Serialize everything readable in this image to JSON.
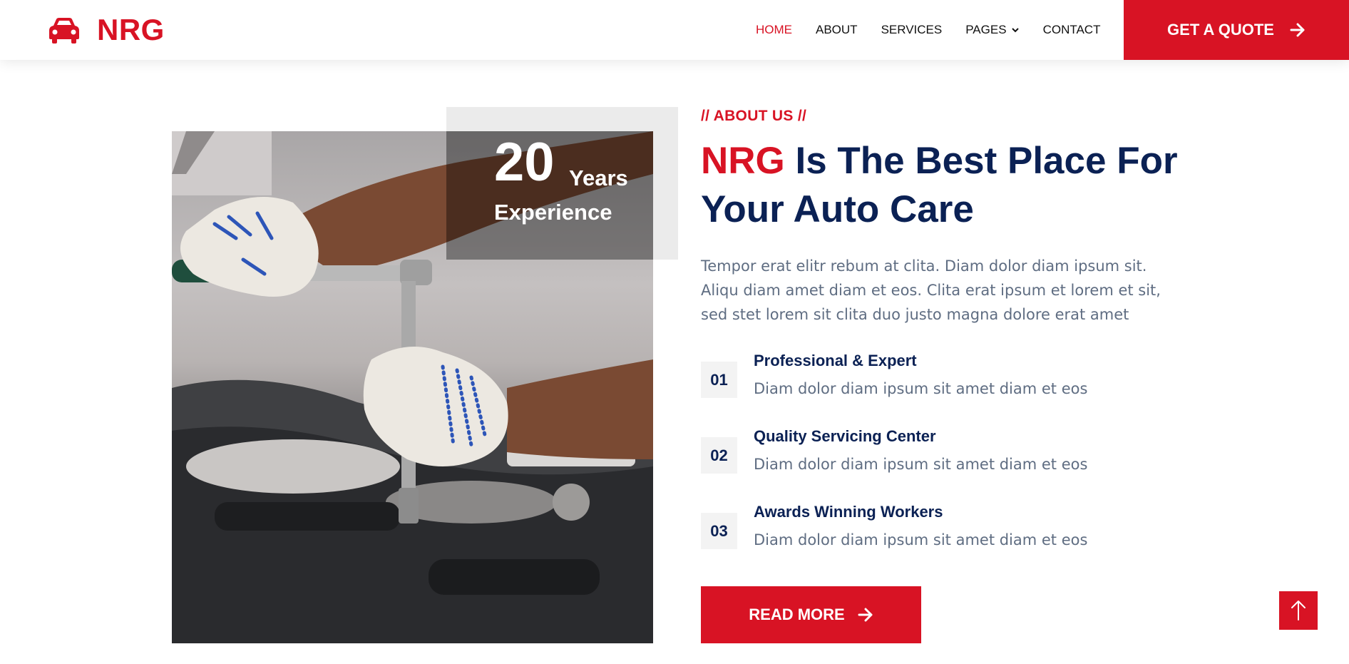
{
  "colors": {
    "primary": "#d81324",
    "navy": "#0b2154",
    "text_muted": "#5f6d82",
    "panel_gray": "#ebebeb"
  },
  "header": {
    "brand": "NRG",
    "brand_icon": "car-icon",
    "nav": [
      {
        "label": "HOME",
        "active": true
      },
      {
        "label": "ABOUT",
        "active": false
      },
      {
        "label": "SERVICES",
        "active": false
      },
      {
        "label": "PAGES",
        "active": false,
        "dropdown": true
      },
      {
        "label": "CONTACT",
        "active": false
      }
    ],
    "cta_label": "GET A QUOTE",
    "cta_icon": "arrow-right-icon"
  },
  "about": {
    "experience_number": "20",
    "experience_unit": "Years",
    "experience_label": "Experience",
    "section_tag": "// ABOUT US //",
    "headline_brand": "NRG",
    "headline_rest": " Is The Best Place For Your Auto Care",
    "intro": "Tempor erat elitr rebum at clita. Diam dolor diam ipsum sit. Aliqu diam amet diam et eos. Clita erat ipsum et lorem et sit, sed stet lorem sit clita duo justo magna dolore erat amet",
    "features": [
      {
        "num": "01",
        "title": "Professional & Expert",
        "desc": "Diam dolor diam ipsum sit amet diam et eos"
      },
      {
        "num": "02",
        "title": "Quality Servicing Center",
        "desc": "Diam dolor diam ipsum sit amet diam et eos"
      },
      {
        "num": "03",
        "title": "Awards Winning Workers",
        "desc": "Diam dolor diam ipsum sit amet diam et eos"
      }
    ],
    "button_label": "READ MORE",
    "button_icon": "arrow-right-icon"
  },
  "back_to_top_icon": "arrow-up-icon"
}
